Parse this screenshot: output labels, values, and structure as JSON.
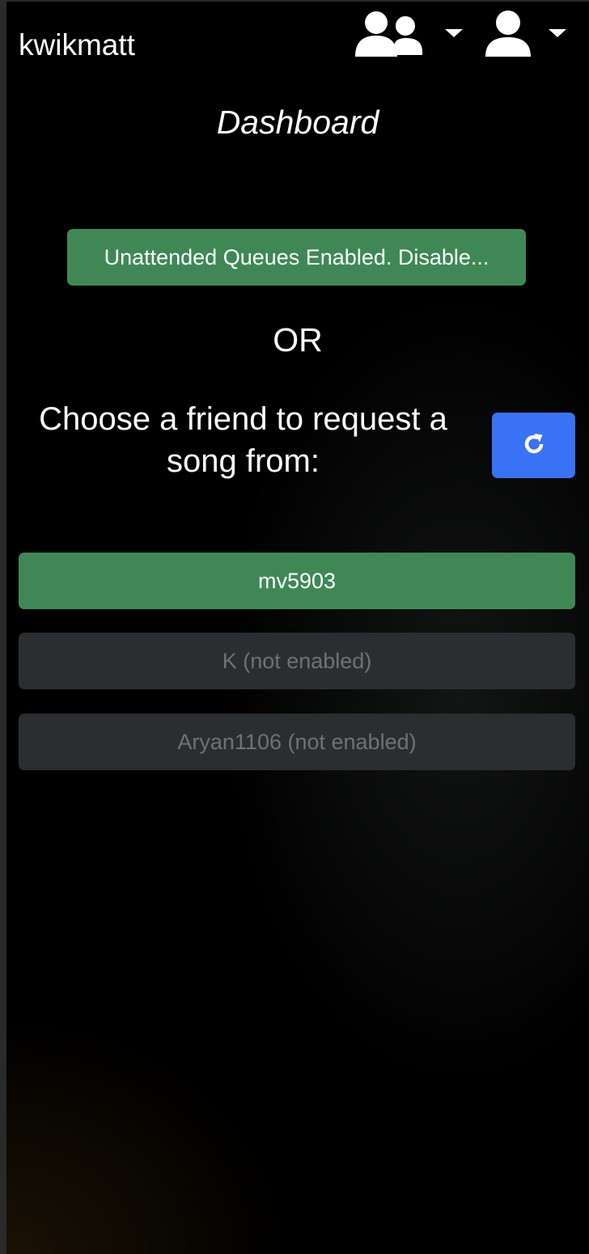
{
  "navbar": {
    "brand": "kwikmatt",
    "icons": [
      "users-icon",
      "user-icon"
    ]
  },
  "dashboard": {
    "title": "Dashboard",
    "unattended_button": "Unattended Queues Enabled. Disable...",
    "or_label": "OR",
    "prompt": "Choose a friend to request a song from:",
    "refresh_icon": "refresh-icon"
  },
  "friends": [
    {
      "label": "mv5903",
      "enabled": true
    },
    {
      "label": "K (not enabled)",
      "enabled": false
    },
    {
      "label": "Aryan1106 (not enabled)",
      "enabled": false
    }
  ],
  "colors": {
    "success": "#3f8856",
    "primary": "#3a72f5",
    "disabled": "#2b2e31",
    "background": "#000000"
  }
}
